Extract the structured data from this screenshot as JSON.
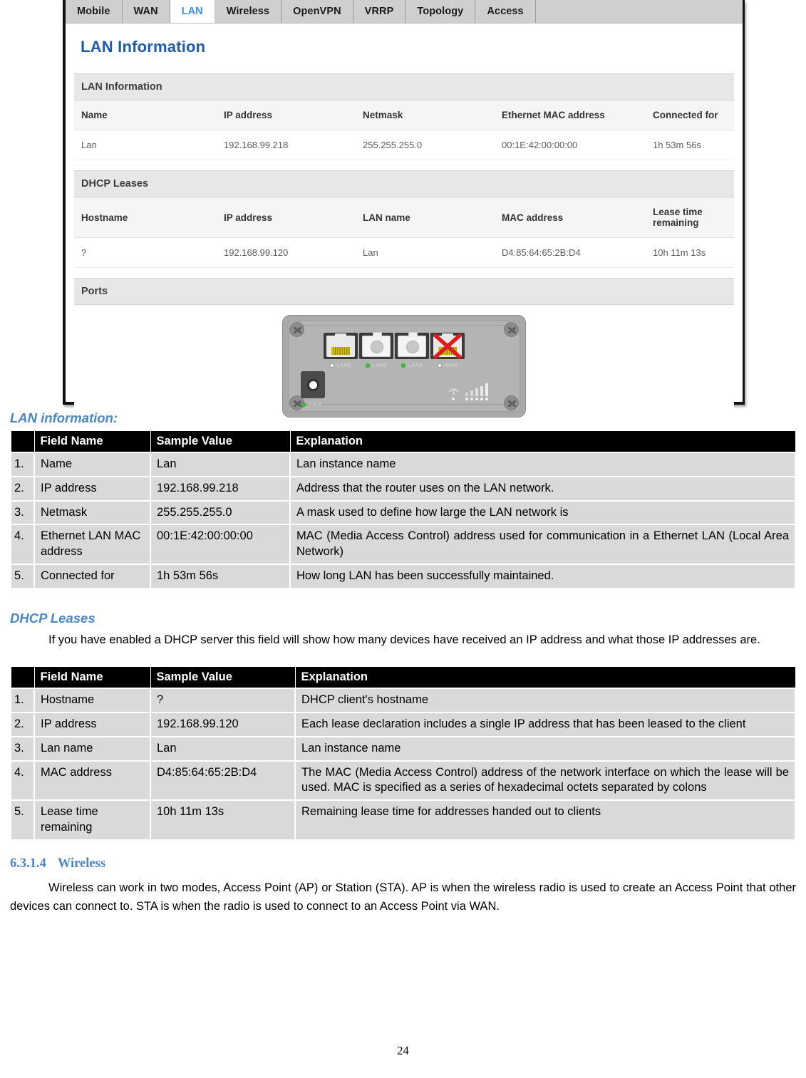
{
  "screenshot": {
    "tabs": [
      {
        "label": "Mobile",
        "active": false
      },
      {
        "label": "WAN",
        "active": false
      },
      {
        "label": "LAN",
        "active": true
      },
      {
        "label": "Wireless",
        "active": false
      },
      {
        "label": "OpenVPN",
        "active": false
      },
      {
        "label": "VRRP",
        "active": false
      },
      {
        "label": "Topology",
        "active": false
      },
      {
        "label": "Access",
        "active": false
      }
    ],
    "page_title": "LAN Information",
    "lan_information": {
      "section_title": "LAN Information",
      "headers": [
        "Name",
        "IP address",
        "Netmask",
        "Ethernet MAC address",
        "Connected for"
      ],
      "rows": [
        [
          "Lan",
          "192.168.99.218",
          "255.255.255.0",
          "00:1E:42:00:00:00",
          "1h 53m 56s"
        ]
      ]
    },
    "dhcp_leases": {
      "section_title": "DHCP Leases",
      "headers": [
        "Hostname",
        "IP address",
        "LAN name",
        "MAC address",
        "Lease time remaining"
      ],
      "rows": [
        [
          "?",
          "192.168.99.120",
          "Lan",
          "D4:85:64:65:2B:D4",
          "10h 11m 13s"
        ]
      ]
    },
    "ports": {
      "section_title": "Ports",
      "port_labels": [
        "LAN1",
        "LAN2",
        "LAN3",
        "WAN"
      ],
      "port_led_states": [
        "off",
        "on",
        "on",
        "off"
      ],
      "wan_disconnected": true,
      "power_label": "PWR",
      "power_led_state": "on"
    },
    "colors": {
      "active_tab_text": "#3d8ee6",
      "page_title": "#1f5ba8",
      "tab_background": "#cfcfcf",
      "led_on": "#35d235",
      "wan_x": "#e01b1b"
    }
  },
  "doc": {
    "lan_info_heading": "LAN information:",
    "table1": {
      "headers": [
        "",
        "Field Name",
        "Sample Value",
        "Explanation"
      ],
      "rows": [
        {
          "idx": "1.",
          "field": "Name",
          "value": "Lan",
          "explanation": "Lan instance name"
        },
        {
          "idx": "2.",
          "field": "IP address",
          "value": "192.168.99.218",
          "explanation": "Address that the router uses on the LAN network."
        },
        {
          "idx": "3.",
          "field": "Netmask",
          "value": "255.255.255.0",
          "explanation": "A mask used to define how large the LAN network is"
        },
        {
          "idx": "4.",
          "field": "Ethernet LAN MAC address",
          "value": "00:1E:42:00:00:00",
          "explanation": "MAC (Media Access Control) address used for communication in a Ethernet LAN  (Local  Area Network)"
        },
        {
          "idx": "5.",
          "field": "Connected for",
          "value": "1h 53m 56s",
          "explanation": "How long LAN has been successfully maintained."
        }
      ]
    },
    "dhcp_heading": "DHCP Leases",
    "dhcp_paragraph": "If you have enabled a DHCP server this field will show how many devices have received an IP address and what those IP addresses are.",
    "table2": {
      "headers": [
        "",
        "Field Name",
        "Sample Value",
        "Explanation"
      ],
      "rows": [
        {
          "idx": "1.",
          "field": "Hostname",
          "value": "?",
          "explanation": "DHCP client's hostname"
        },
        {
          "idx": "2.",
          "field": "IP address",
          "value": "192.168.99.120",
          "explanation": "Each lease declaration includes a single IP address that has been leased to the client"
        },
        {
          "idx": "3.",
          "field": "Lan name",
          "value": "Lan",
          "explanation": "Lan instance name"
        },
        {
          "idx": "4.",
          "field": "MAC address",
          "value": "D4:85:64:65:2B:D4",
          "explanation": "The MAC (Media Access Control) address of the network interface on which the lease will be used. MAC is specified as a series of hexadecimal octets separated by colons"
        },
        {
          "idx": "5.",
          "field": "Lease time remaining",
          "value": "10h 11m 13s",
          "explanation": "Remaining lease time for addresses handed out to clients"
        }
      ]
    },
    "wireless_section": {
      "number": "6.3.1.4",
      "title": "Wireless",
      "paragraph": "Wireless can work in two modes, Access Point (AP) or Station (STA). AP is when the wireless radio is used to create an Access Point that other devices can connect to. STA is when the radio is used to connect to an Access Point via WAN."
    },
    "page_number": "24"
  }
}
